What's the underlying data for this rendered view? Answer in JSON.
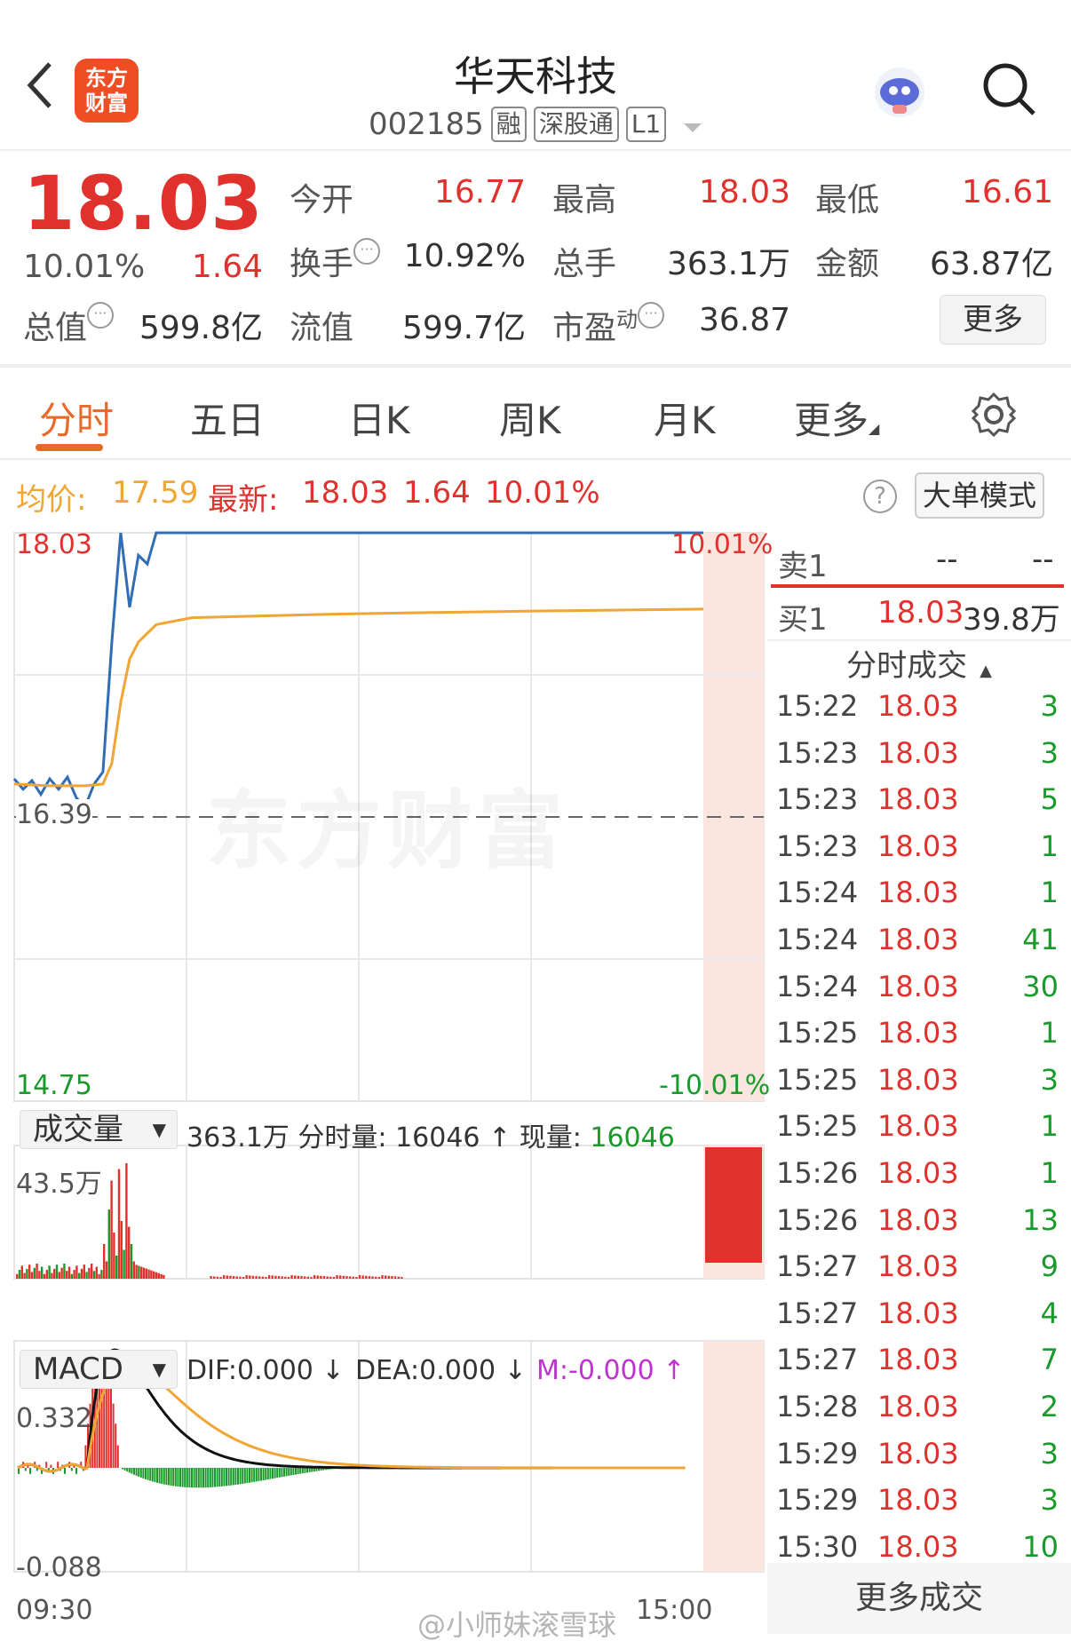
{
  "header": {
    "title": "华天科技",
    "code": "002185",
    "tags": [
      "融",
      "深股通",
      "L1"
    ],
    "logo_text": [
      "东方",
      "财富"
    ]
  },
  "quote": {
    "price": "18.03",
    "change_pct": "10.01%",
    "change": "1.64",
    "open_label": "今开",
    "open": "16.77",
    "high_label": "最高",
    "high": "18.03",
    "low_label": "最低",
    "low": "16.61",
    "turnover_label": "换手",
    "turnover": "10.92%",
    "volume_label": "总手",
    "volume": "363.1万",
    "amount_label": "金额",
    "amount": "63.87亿",
    "mktcap_label": "总值",
    "mktcap": "599.8亿",
    "float_label": "流值",
    "float": "599.7亿",
    "pe_label": "市盈",
    "pe_sup": "动",
    "pe": "36.87",
    "more": "更多"
  },
  "tabs": [
    "分时",
    "五日",
    "日K",
    "周K",
    "月K",
    "更多"
  ],
  "info": {
    "avg_label": "均价:",
    "avg": "17.59",
    "last_label": "最新:",
    "last": "18.03",
    "last_change": "1.64",
    "last_pct": "10.01%",
    "big_order": "大单模式"
  },
  "price_chart": {
    "top_left": "18.03",
    "top_right": "10.01%",
    "mid": "16.39",
    "bottom_left": "14.75",
    "bottom_right": "-10.01%",
    "watermark": "东方财富"
  },
  "volume": {
    "selector": "成交量",
    "summary": "363.1万 分时量: 16046 ↑ 现量:",
    "current": "16046",
    "axis_max": "43.5万"
  },
  "macd": {
    "selector": "MACD",
    "dif": "DIF:0.000 ↓",
    "dea": "DEA:0.000 ↓",
    "m": "M:-0.000 ↑",
    "axis_max": "0.332",
    "axis_min": "-0.088"
  },
  "x_axis": {
    "start": "09:30",
    "end": "15:00"
  },
  "orderbook": {
    "sell_label": "卖1",
    "sell_price": "--",
    "sell_vol": "--",
    "buy_label": "买1",
    "buy_price": "18.03",
    "buy_vol": "39.8万",
    "ticks_header": "分时成交"
  },
  "ticks": [
    {
      "t": "15:22",
      "p": "18.03",
      "v": "3"
    },
    {
      "t": "15:23",
      "p": "18.03",
      "v": "3"
    },
    {
      "t": "15:23",
      "p": "18.03",
      "v": "5"
    },
    {
      "t": "15:23",
      "p": "18.03",
      "v": "1"
    },
    {
      "t": "15:24",
      "p": "18.03",
      "v": "1"
    },
    {
      "t": "15:24",
      "p": "18.03",
      "v": "41"
    },
    {
      "t": "15:24",
      "p": "18.03",
      "v": "30"
    },
    {
      "t": "15:25",
      "p": "18.03",
      "v": "1"
    },
    {
      "t": "15:25",
      "p": "18.03",
      "v": "3"
    },
    {
      "t": "15:25",
      "p": "18.03",
      "v": "1"
    },
    {
      "t": "15:26",
      "p": "18.03",
      "v": "1"
    },
    {
      "t": "15:26",
      "p": "18.03",
      "v": "13"
    },
    {
      "t": "15:27",
      "p": "18.03",
      "v": "9"
    },
    {
      "t": "15:27",
      "p": "18.03",
      "v": "4"
    },
    {
      "t": "15:27",
      "p": "18.03",
      "v": "7"
    },
    {
      "t": "15:28",
      "p": "18.03",
      "v": "2"
    },
    {
      "t": "15:29",
      "p": "18.03",
      "v": "3"
    },
    {
      "t": "15:29",
      "p": "18.03",
      "v": "3"
    },
    {
      "t": "15:30",
      "p": "18.03",
      "v": "10"
    }
  ],
  "more_trades": "更多成交",
  "watermark_footer": "@小师妹滚雪球",
  "colors": {
    "up": "#e0312d",
    "down": "#1a9a2a",
    "price_line": "#2f6db5",
    "avg_line": "#f0a534",
    "accent": "#e86a2a"
  },
  "chart_data": {
    "type": "line",
    "x_range": [
      "09:30",
      "15:00"
    ],
    "ylim": [
      14.75,
      18.03
    ],
    "prev_close": 16.39,
    "series": [
      {
        "name": "最新",
        "x": [
          0,
          5,
          10,
          15,
          20,
          25,
          30,
          35,
          40,
          45,
          50,
          55,
          60,
          65,
          70,
          75,
          80,
          85,
          90,
          95,
          100
        ],
        "values": [
          16.61,
          16.55,
          16.6,
          16.52,
          16.61,
          16.55,
          16.62,
          16.5,
          16.45,
          16.58,
          16.65,
          17.4,
          18.03,
          17.6,
          17.9,
          17.85,
          18.03,
          18.03,
          18.03,
          18.03,
          18.03
        ]
      },
      {
        "name": "均价",
        "x": [
          0,
          20,
          40,
          50,
          55,
          60,
          65,
          70,
          80,
          100,
          150,
          200,
          260,
          330
        ],
        "values": [
          16.58,
          16.57,
          16.57,
          16.58,
          16.7,
          17.05,
          17.3,
          17.4,
          17.5,
          17.54,
          17.56,
          17.57,
          17.58,
          17.59
        ]
      }
    ]
  }
}
